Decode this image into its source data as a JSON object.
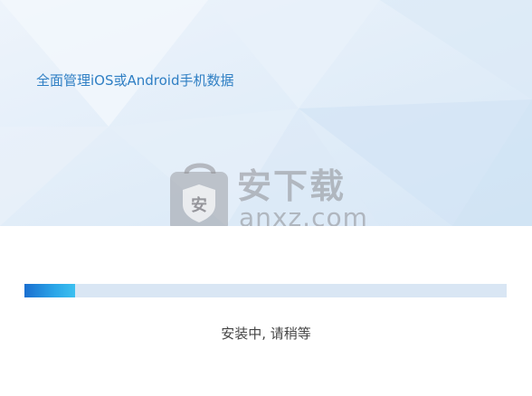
{
  "header": {
    "tagline": "全面管理iOS或Android手机数据"
  },
  "watermark": {
    "title": "安下载",
    "url": "anxz.com",
    "badge_char": "安"
  },
  "progress": {
    "value_fraction": 0.105,
    "fill_color": "#2aa6e8",
    "track_color": "#d9e6f4"
  },
  "status": {
    "text": "安装中, 请稍等"
  }
}
